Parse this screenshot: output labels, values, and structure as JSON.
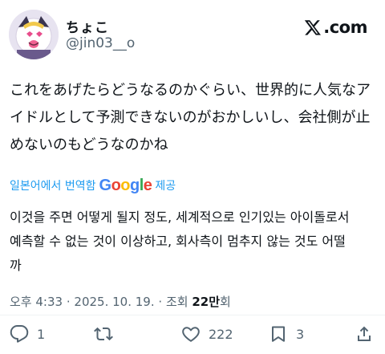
{
  "header": {
    "display_name": "ちょこ",
    "handle": "@jin03__o",
    "brand": "X.com",
    "brand_text": ".com"
  },
  "tweet": {
    "text": "これをあげたらどうなるのかぐらい、世界的に人気なア\nイドルとして予測できないのがおかしいし、会社側が止\nめないのもどうなのかね"
  },
  "translation": {
    "label": "일본어에서 번역함",
    "provider": "Google",
    "suffix": "제공",
    "text": "이것을 주면 어떻게 될지 정도, 세계적으로 인기있는 아이돌로서\n예측할 수 없는 것이 이상하고, 회사측이 멈추지 않는 것도 어떨\n까"
  },
  "meta": {
    "time": "오후 4:33",
    "date": "2025. 10. 19.",
    "views_label": "조회",
    "views_count": "22만",
    "views_suffix": "회",
    "separator": "·"
  },
  "actions": {
    "reply_count": "1",
    "repost_count": "",
    "like_count": "222",
    "bookmark_count": "3"
  },
  "icons": {
    "reply": "reply-icon",
    "repost": "repost-icon",
    "like": "heart-icon",
    "bookmark": "bookmark-icon",
    "share": "share-icon"
  },
  "colors": {
    "link": "#1d9bf0",
    "secondary": "#536471",
    "google_blue": "#4285F4",
    "google_red": "#EA4335",
    "google_yellow": "#FBBC05",
    "google_green": "#34A853"
  }
}
